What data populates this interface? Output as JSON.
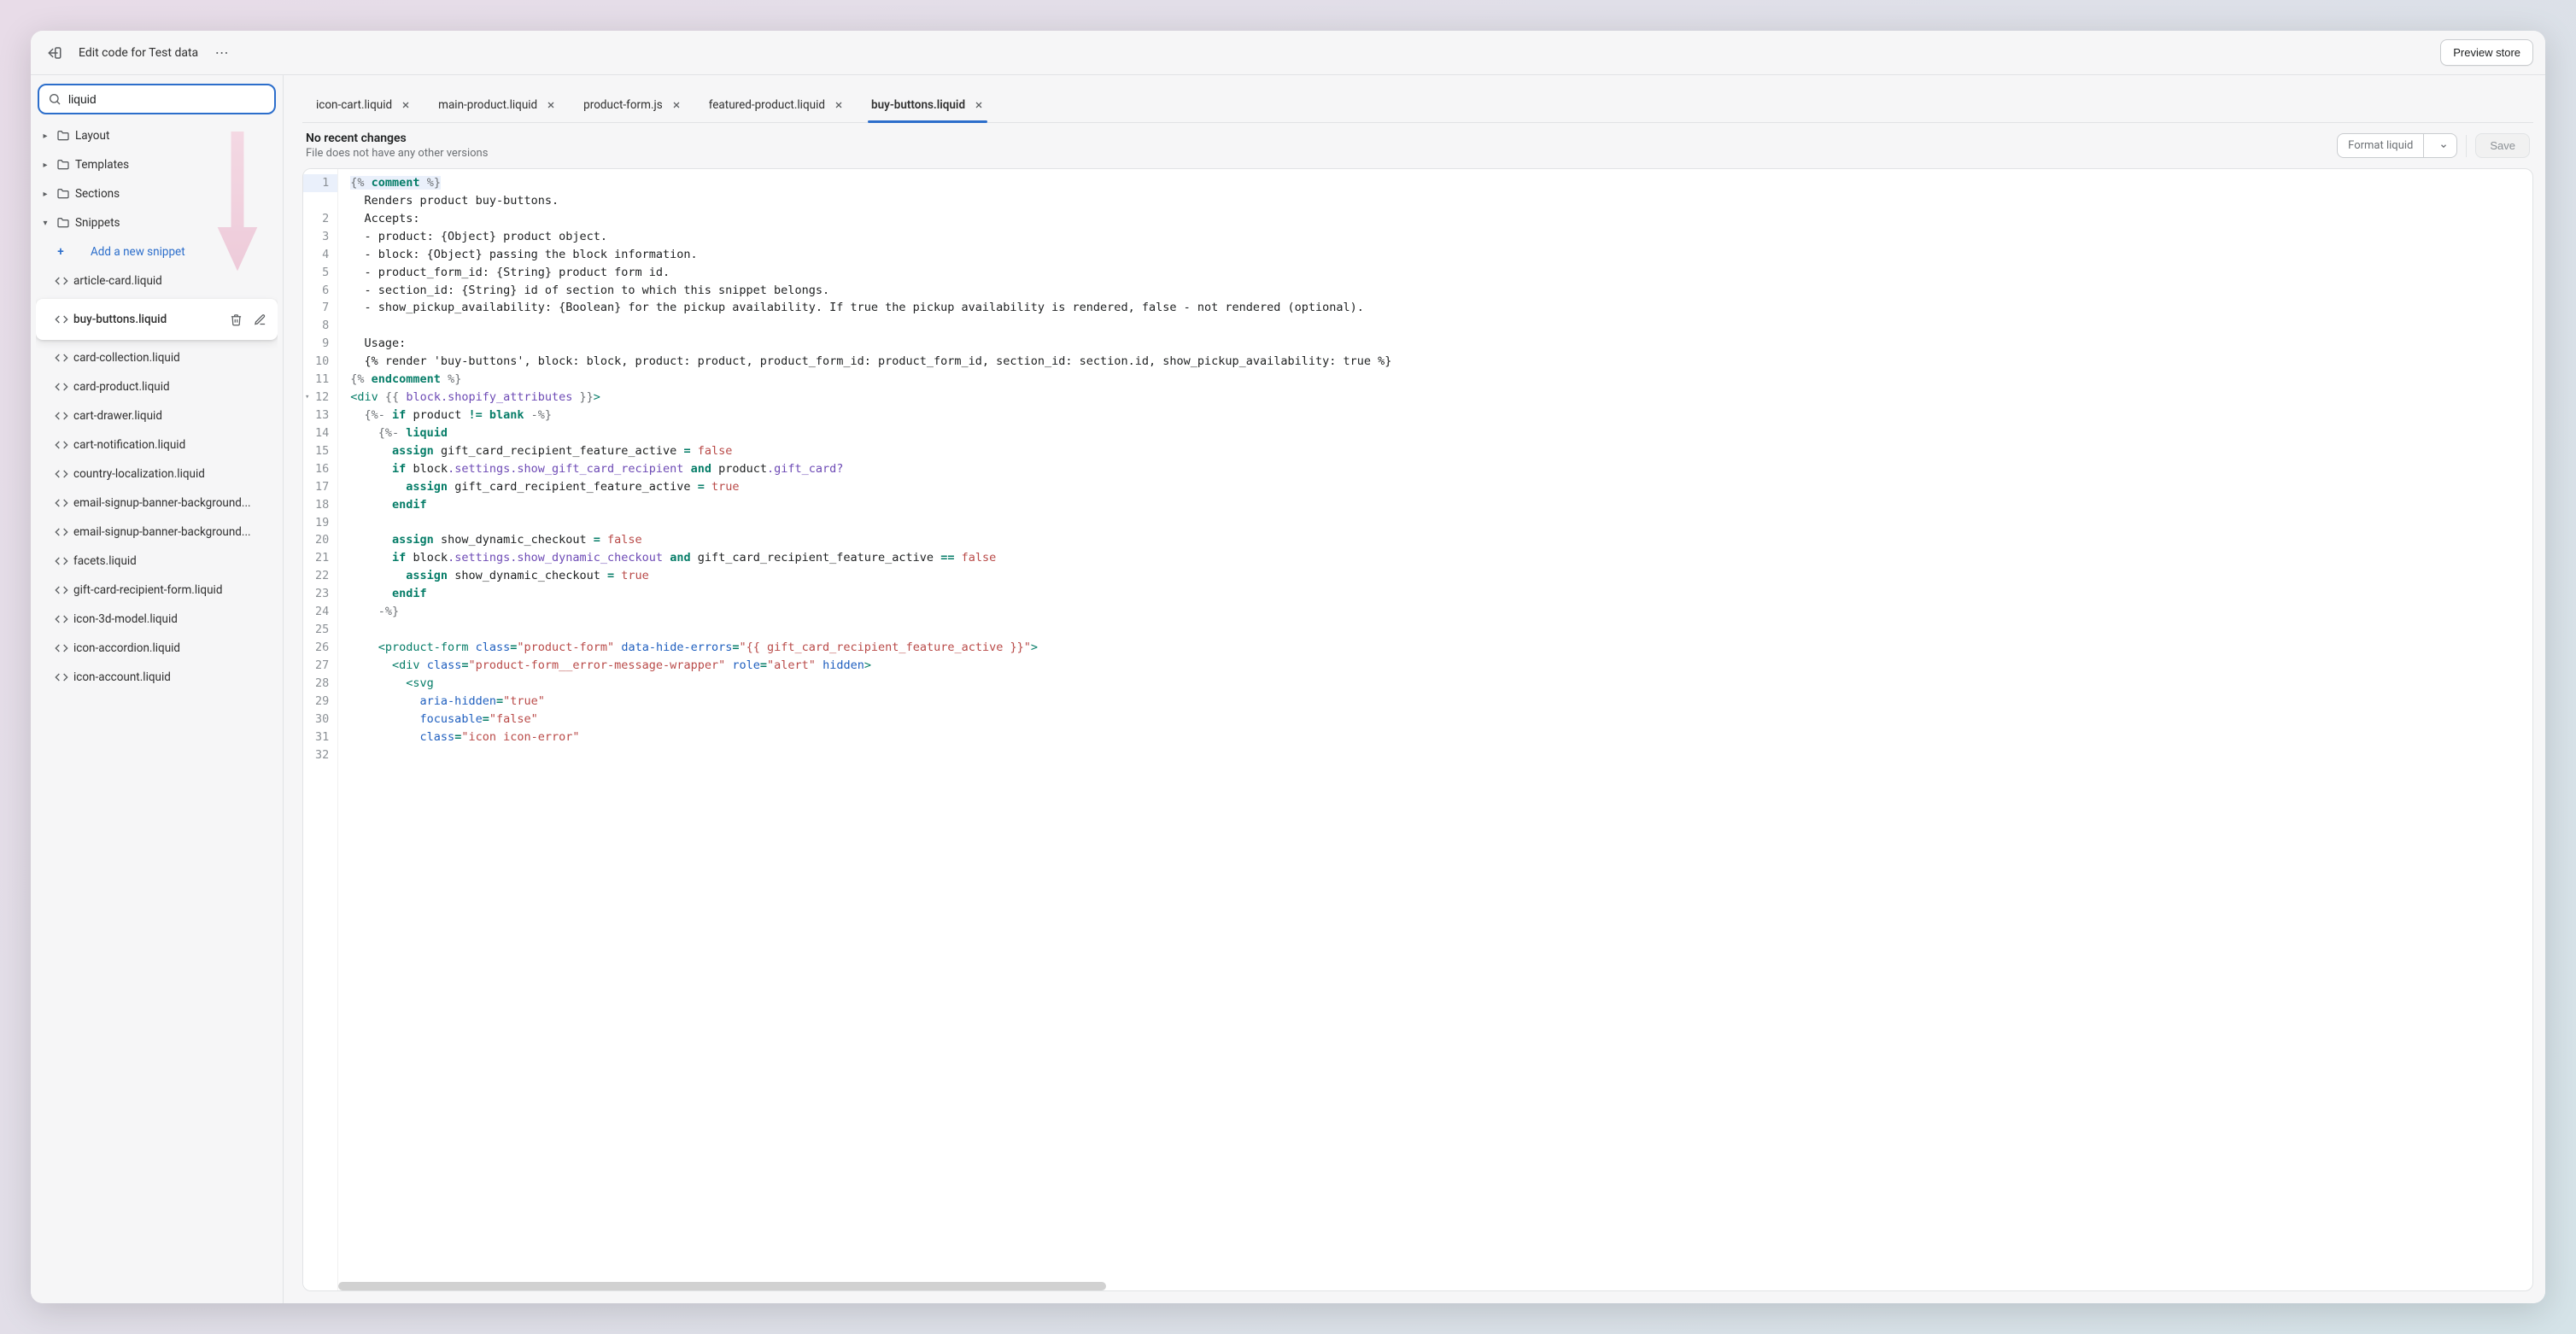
{
  "topbar": {
    "title": "Edit code for Test data",
    "preview_label": "Preview store"
  },
  "sidebar": {
    "search_value": "liquid",
    "folders": [
      {
        "label": "Layout",
        "expanded": false
      },
      {
        "label": "Templates",
        "expanded": false
      },
      {
        "label": "Sections",
        "expanded": false
      },
      {
        "label": "Snippets",
        "expanded": true
      }
    ],
    "add_label": "Add a new snippet",
    "files": [
      "article-card.liquid",
      "buy-buttons.liquid",
      "card-collection.liquid",
      "card-product.liquid",
      "cart-drawer.liquid",
      "cart-notification.liquid",
      "country-localization.liquid",
      "email-signup-banner-background...",
      "email-signup-banner-background...",
      "facets.liquid",
      "gift-card-recipient-form.liquid",
      "icon-3d-model.liquid",
      "icon-accordion.liquid",
      "icon-account.liquid"
    ],
    "selected_index": 1
  },
  "tabs": [
    {
      "label": "icon-cart.liquid",
      "active": false
    },
    {
      "label": "main-product.liquid",
      "active": false
    },
    {
      "label": "product-form.js",
      "active": false
    },
    {
      "label": "featured-product.liquid",
      "active": false
    },
    {
      "label": "buy-buttons.liquid",
      "active": true
    }
  ],
  "status": {
    "title": "No recent changes",
    "sub": "File does not have any other versions",
    "format_label": "Format liquid",
    "save_label": "Save"
  },
  "code": {
    "first_line": 1,
    "highlight_line": 1,
    "fold_marker_line": 13,
    "lines": [
      [
        [
          "delim",
          "{% "
        ],
        [
          "kw",
          "comment"
        ],
        [
          "delim",
          " %}"
        ]
      ],
      [
        [
          "",
          "  Renders product buy-buttons."
        ]
      ],
      [
        [
          "",
          "  Accepts:"
        ]
      ],
      [
        [
          "",
          "  - product: {Object} product object."
        ]
      ],
      [
        [
          "",
          "  - block: {Object} passing the block information."
        ]
      ],
      [
        [
          "",
          "  - product_form_id: {String} product form id."
        ]
      ],
      [
        [
          "",
          "  - section_id: {String} id of section to which this snippet belongs."
        ]
      ],
      [
        [
          "",
          "  - show_pickup_availability: {Boolean} for the pickup availability. If true the pickup availability is rendered, false - not rendered (optional)."
        ]
      ],
      [],
      [
        [
          "",
          "  Usage:"
        ]
      ],
      [
        [
          "",
          "  {% render 'buy-buttons', block: block, product: product, product_form_id: product_form_id, section_id: section.id, show_pickup_availability: true %}"
        ]
      ],
      [
        [
          "delim",
          "{% "
        ],
        [
          "kw",
          "endcomment"
        ],
        [
          "delim",
          " %}"
        ]
      ],
      [
        [
          "tag",
          "<div"
        ],
        [
          "",
          " "
        ],
        [
          "delim",
          "{{ "
        ],
        [
          "prop",
          "block.shopify_attributes"
        ],
        [
          "delim",
          " }}"
        ],
        [
          "tag",
          ">"
        ]
      ],
      [
        [
          "",
          "  "
        ],
        [
          "delim",
          "{%- "
        ],
        [
          "kw",
          "if"
        ],
        [
          "",
          " product "
        ],
        [
          "kw",
          "!="
        ],
        [
          "",
          " "
        ],
        [
          "kw",
          "blank"
        ],
        [
          "delim",
          " -%}"
        ]
      ],
      [
        [
          "",
          "    "
        ],
        [
          "delim",
          "{%- "
        ],
        [
          "kw",
          "liquid"
        ]
      ],
      [
        [
          "",
          "      "
        ],
        [
          "kw",
          "assign"
        ],
        [
          "",
          " gift_card_recipient_feature_active "
        ],
        [
          "kw",
          "="
        ],
        [
          "",
          " "
        ],
        [
          "bool",
          "false"
        ]
      ],
      [
        [
          "",
          "      "
        ],
        [
          "kw",
          "if"
        ],
        [
          "",
          " block"
        ],
        [
          "prop",
          ".settings.show_gift_card_recipient"
        ],
        [
          "",
          " "
        ],
        [
          "kw",
          "and"
        ],
        [
          "",
          " product"
        ],
        [
          "prop",
          ".gift_card?"
        ]
      ],
      [
        [
          "",
          "        "
        ],
        [
          "kw",
          "assign"
        ],
        [
          "",
          " gift_card_recipient_feature_active "
        ],
        [
          "kw",
          "="
        ],
        [
          "",
          " "
        ],
        [
          "bool",
          "true"
        ]
      ],
      [
        [
          "",
          "      "
        ],
        [
          "kw",
          "endif"
        ]
      ],
      [],
      [
        [
          "",
          "      "
        ],
        [
          "kw",
          "assign"
        ],
        [
          "",
          " show_dynamic_checkout "
        ],
        [
          "kw",
          "="
        ],
        [
          "",
          " "
        ],
        [
          "bool",
          "false"
        ]
      ],
      [
        [
          "",
          "      "
        ],
        [
          "kw",
          "if"
        ],
        [
          "",
          " block"
        ],
        [
          "prop",
          ".settings.show_dynamic_checkout"
        ],
        [
          "",
          " "
        ],
        [
          "kw",
          "and"
        ],
        [
          "",
          " gift_card_recipient_feature_active "
        ],
        [
          "kw",
          "=="
        ],
        [
          "",
          " "
        ],
        [
          "bool",
          "false"
        ]
      ],
      [
        [
          "",
          "        "
        ],
        [
          "kw",
          "assign"
        ],
        [
          "",
          " show_dynamic_checkout "
        ],
        [
          "kw",
          "="
        ],
        [
          "",
          " "
        ],
        [
          "bool",
          "true"
        ]
      ],
      [
        [
          "",
          "      "
        ],
        [
          "kw",
          "endif"
        ]
      ],
      [
        [
          "",
          "    "
        ],
        [
          "delim",
          "-%}"
        ]
      ],
      [],
      [
        [
          "",
          "    "
        ],
        [
          "tag",
          "<product-form"
        ],
        [
          "",
          " "
        ],
        [
          "attr",
          "class"
        ],
        [
          "kw",
          "="
        ],
        [
          "str",
          "\"product-form\""
        ],
        [
          "",
          " "
        ],
        [
          "attr",
          "data-hide-errors"
        ],
        [
          "kw",
          "="
        ],
        [
          "str",
          "\"{{ gift_card_recipient_feature_active }}\""
        ],
        [
          "tag",
          ">"
        ]
      ],
      [
        [
          "",
          "      "
        ],
        [
          "tag",
          "<div"
        ],
        [
          "",
          " "
        ],
        [
          "attr",
          "class"
        ],
        [
          "kw",
          "="
        ],
        [
          "str",
          "\"product-form__error-message-wrapper\""
        ],
        [
          "",
          " "
        ],
        [
          "attr",
          "role"
        ],
        [
          "kw",
          "="
        ],
        [
          "str",
          "\"alert\""
        ],
        [
          "",
          " "
        ],
        [
          "attr",
          "hidden"
        ],
        [
          "tag",
          ">"
        ]
      ],
      [
        [
          "",
          "        "
        ],
        [
          "tag",
          "<svg"
        ]
      ],
      [
        [
          "",
          "          "
        ],
        [
          "attr",
          "aria-hidden"
        ],
        [
          "kw",
          "="
        ],
        [
          "str",
          "\"true\""
        ]
      ],
      [
        [
          "",
          "          "
        ],
        [
          "attr",
          "focusable"
        ],
        [
          "kw",
          "="
        ],
        [
          "str",
          "\"false\""
        ]
      ],
      [
        [
          "",
          "          "
        ],
        [
          "attr",
          "class"
        ],
        [
          "kw",
          "="
        ],
        [
          "str",
          "\"icon icon-error\""
        ]
      ]
    ]
  }
}
